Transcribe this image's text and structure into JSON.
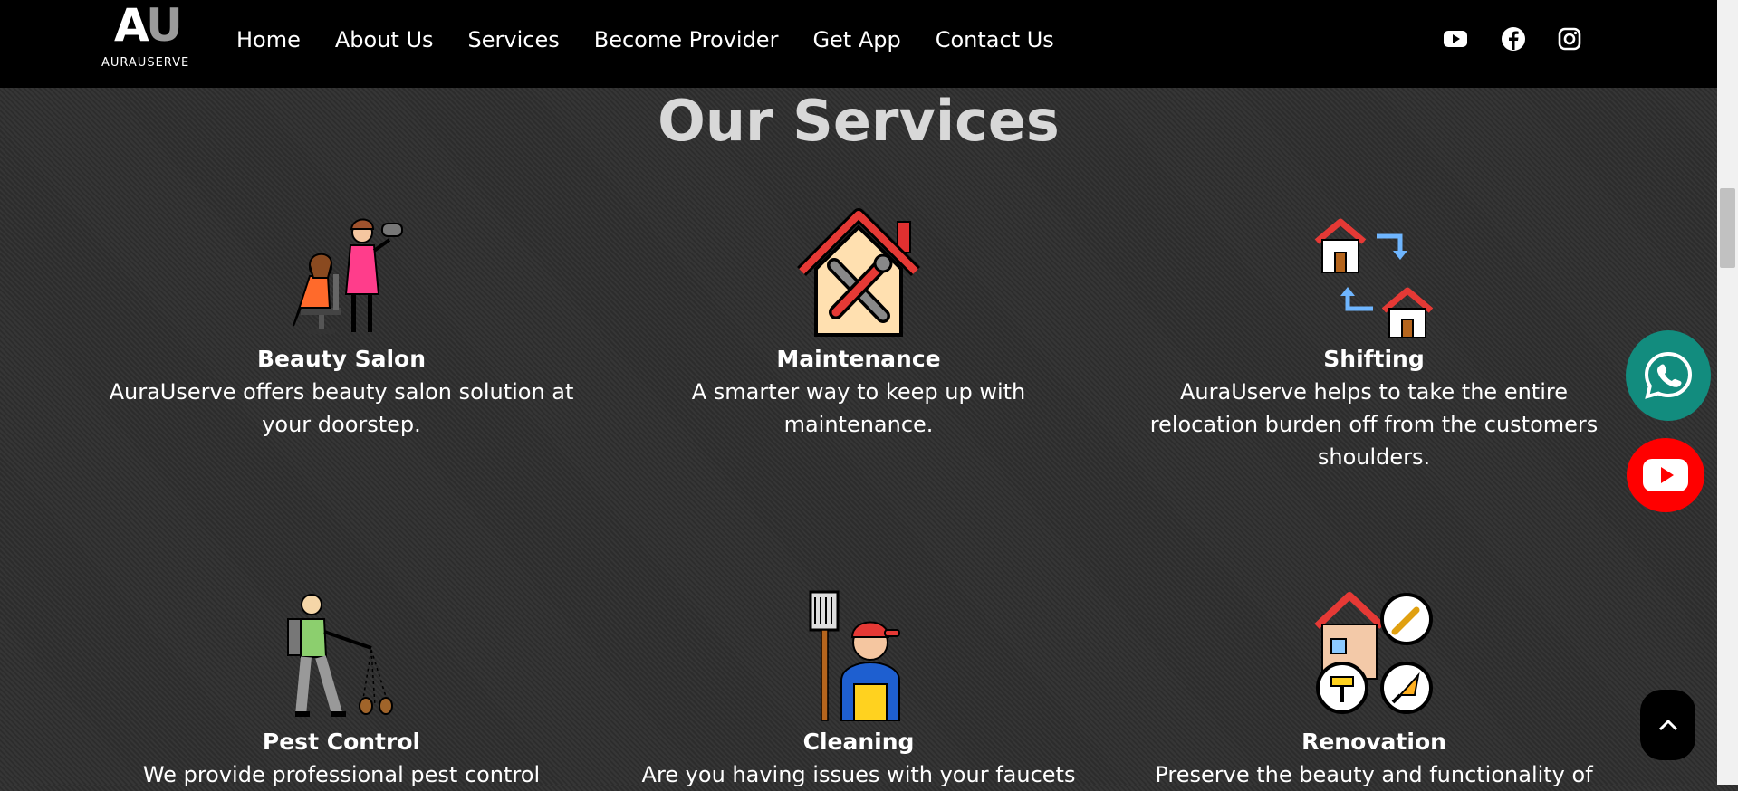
{
  "brand": {
    "logo_mark_a": "A",
    "logo_mark_u": "U",
    "logo_text": "AURAUSERVE"
  },
  "nav": {
    "items": [
      {
        "label": "Home"
      },
      {
        "label": "About Us"
      },
      {
        "label": "Services"
      },
      {
        "label": "Become Provider"
      },
      {
        "label": "Get App"
      },
      {
        "label": "Contact Us"
      }
    ],
    "social": [
      "youtube-icon",
      "facebook-icon",
      "instagram-icon"
    ]
  },
  "section": {
    "title": "Our Services"
  },
  "services": [
    {
      "title": "Beauty Salon",
      "description": "AuraUserve offers beauty salon solution at your doorstep.",
      "icon": "salon-icon"
    },
    {
      "title": "Maintenance",
      "description": "A smarter way to keep up with maintenance.",
      "icon": "house-tools-icon"
    },
    {
      "title": "Shifting",
      "description": "AuraUserve helps to take the entire relocation burden off from the customers shoulders.",
      "icon": "house-move-icon"
    },
    {
      "title": "Pest Control",
      "description": "We provide professional pest control",
      "icon": "pest-spray-icon"
    },
    {
      "title": "Cleaning",
      "description": "Are you having issues with your faucets",
      "icon": "cleaner-icon"
    },
    {
      "title": "Renovation",
      "description": "Preserve the beauty and functionality of",
      "icon": "renovation-icon"
    }
  ],
  "floating": [
    "whatsapp-icon",
    "youtube-icon",
    "chevron-up-icon"
  ],
  "colors": {
    "nav_bg": "#000000",
    "whatsapp": "#128c7e",
    "youtube": "#ff0000",
    "heading": "#d8d8d8"
  }
}
